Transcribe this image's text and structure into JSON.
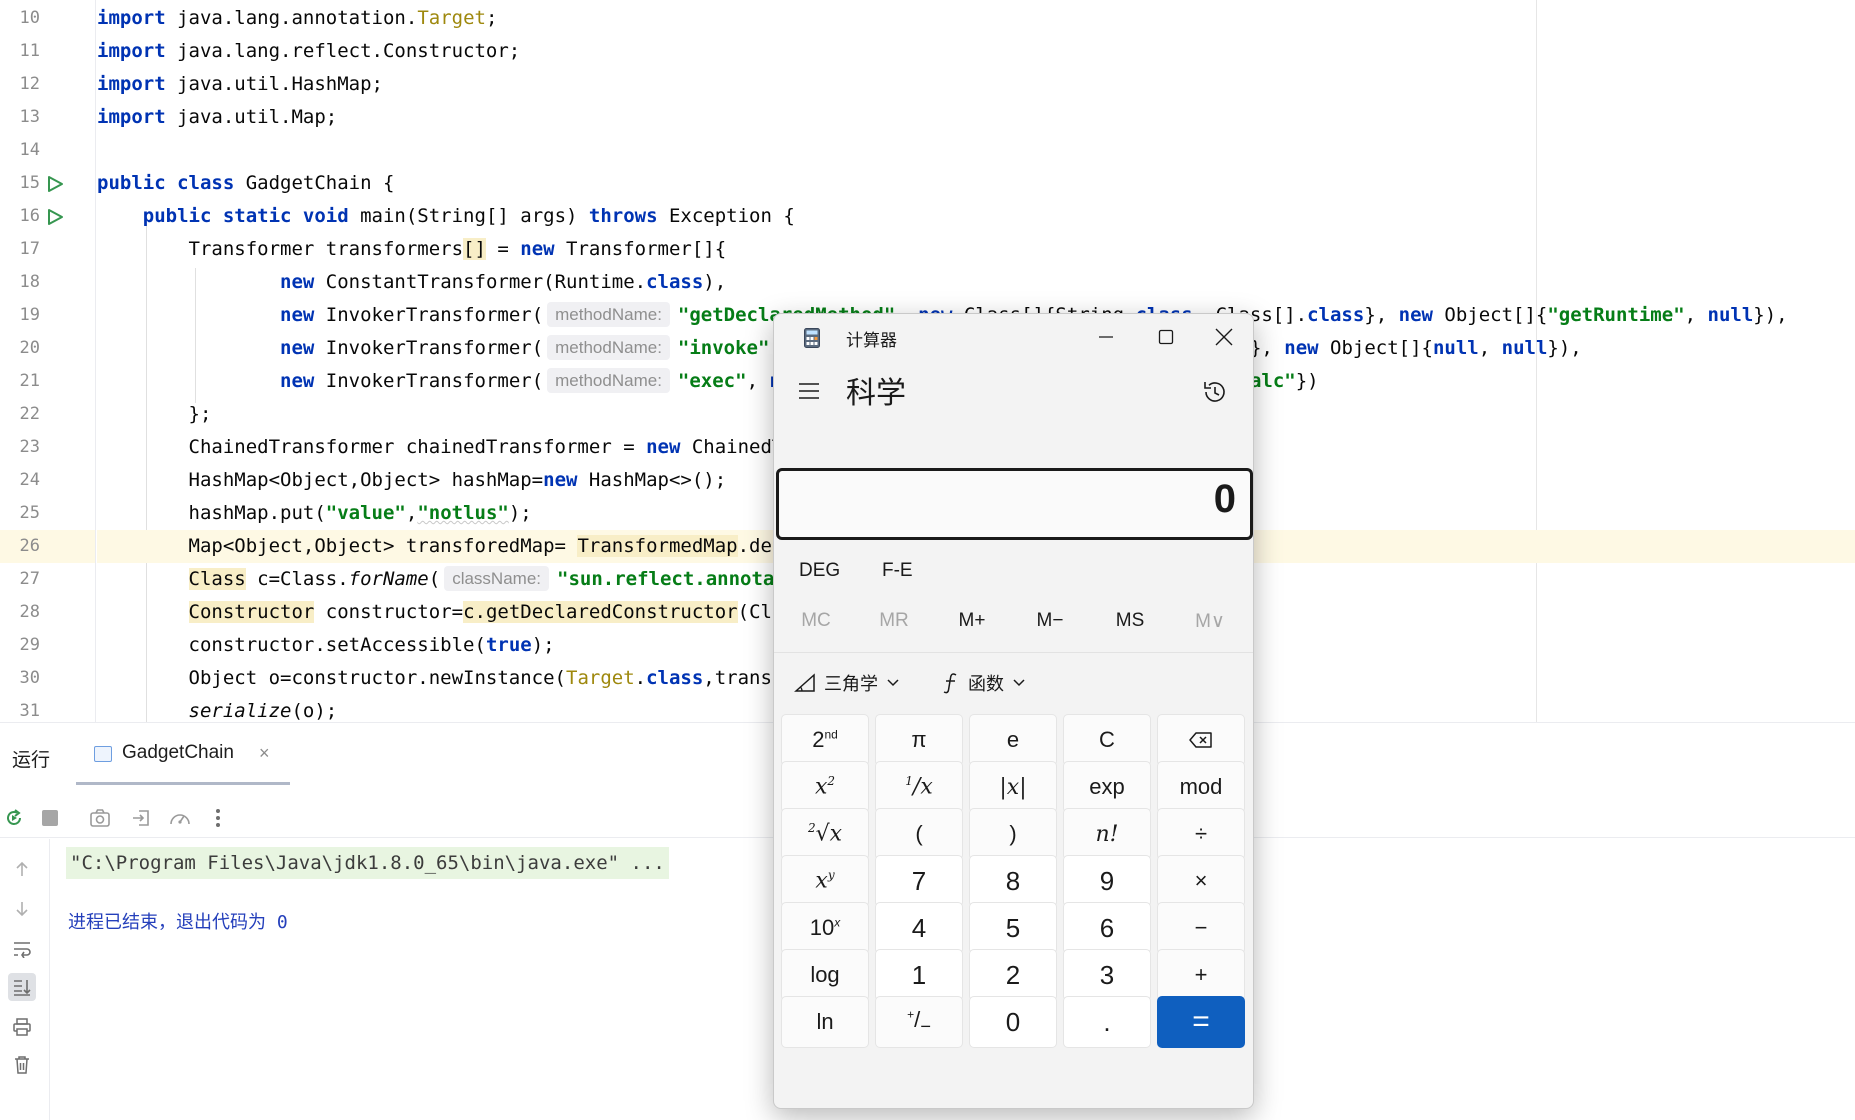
{
  "editor": {
    "lines": [
      {
        "no": "10"
      },
      {
        "no": "11"
      },
      {
        "no": "12"
      },
      {
        "no": "13"
      },
      {
        "no": "14"
      },
      {
        "no": "15"
      },
      {
        "no": "16"
      },
      {
        "no": "17"
      },
      {
        "no": "18"
      },
      {
        "no": "19"
      },
      {
        "no": "20"
      },
      {
        "no": "21"
      },
      {
        "no": "22"
      },
      {
        "no": "23"
      },
      {
        "no": "24"
      },
      {
        "no": "25"
      },
      {
        "no": "26"
      },
      {
        "no": "27"
      },
      {
        "no": "28"
      },
      {
        "no": "29"
      },
      {
        "no": "30"
      },
      {
        "no": "31"
      }
    ],
    "current_line": "26",
    "run_gutter_lines": [
      "15",
      "16"
    ]
  },
  "run_panel": {
    "title": "运行",
    "tab_label": "GadgetChain",
    "tab_close": "×",
    "command": "\"C:\\Program Files\\Java\\jdk1.8.0_65\\bin\\java.exe\" ...",
    "exit_message": "进程已结束，退出代码为 0"
  },
  "calculator": {
    "window_title": "计算器",
    "mode_title": "科学",
    "display_value": "0",
    "angle_mode": "DEG",
    "fe_label": "F-E",
    "memory": [
      "MC",
      "MR",
      "M+",
      "M−",
      "MS",
      "M∨"
    ],
    "trig_label": "三角学",
    "func_label": "函数",
    "keys": {
      "r1": [
        "π",
        "e",
        "C"
      ],
      "abs": "|x|",
      "exp": "exp",
      "mod": "mod",
      "open_paren": "(",
      "close_paren": ")",
      "fact": "n!",
      "divide": "÷",
      "seven": "7",
      "eight": "8",
      "nine": "9",
      "multiply": "×",
      "four": "4",
      "five": "5",
      "six": "6",
      "minus": "−",
      "log": "log",
      "one": "1",
      "two": "2",
      "three": "3",
      "plus": "+",
      "ln": "ln",
      "zero": "0",
      "dot": ".",
      "equals": "="
    }
  }
}
